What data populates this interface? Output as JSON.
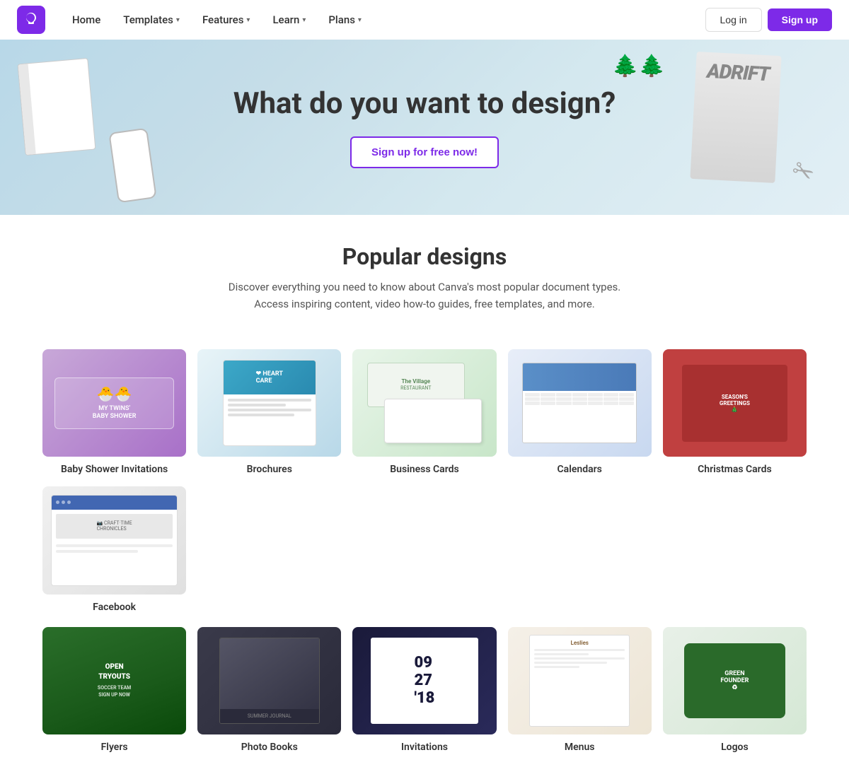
{
  "nav": {
    "logo_label": "Canva",
    "home_label": "Home",
    "templates_label": "Templates",
    "features_label": "Features",
    "learn_label": "Learn",
    "plans_label": "Plans",
    "login_label": "Log in",
    "signup_label": "Sign up"
  },
  "hero": {
    "title": "What do you want to design?",
    "cta_label": "Sign up for free now!",
    "magazine_text": "ADRIFT",
    "cones_emoji": "🌲🌲",
    "scissors_emoji": "✂"
  },
  "popular": {
    "title": "Popular designs",
    "description": "Discover everything you need to know about Canva's most popular document types. Access inspiring content, video how-to guides, free templates, and more."
  },
  "row1": [
    {
      "id": "baby-shower",
      "label": "Baby Shower Invitations",
      "thumb_type": "baby-shower"
    },
    {
      "id": "brochures",
      "label": "Brochures",
      "thumb_type": "brochures"
    },
    {
      "id": "business-cards",
      "label": "Business Cards",
      "thumb_type": "business-cards"
    },
    {
      "id": "calendars",
      "label": "Calendars",
      "thumb_type": "calendars"
    },
    {
      "id": "christmas-cards",
      "label": "Christmas Cards",
      "thumb_type": "christmas-cards"
    }
  ],
  "row2": [
    {
      "id": "flyers",
      "label": "Flyers",
      "thumb_type": "flyers"
    },
    {
      "id": "photo-books",
      "label": "Photo Books",
      "thumb_type": "photo-books"
    },
    {
      "id": "invitations",
      "label": "Invitations",
      "thumb_type": "invitations"
    },
    {
      "id": "menus",
      "label": "Menus",
      "thumb_type": "menus"
    },
    {
      "id": "logos",
      "label": "Logos",
      "thumb_type": "logos"
    }
  ],
  "colors": {
    "brand_purple": "#7d2ae8",
    "nav_bg": "#ffffff",
    "hero_bg_start": "#b8d8e8",
    "hero_bg_end": "#e2eff5"
  }
}
